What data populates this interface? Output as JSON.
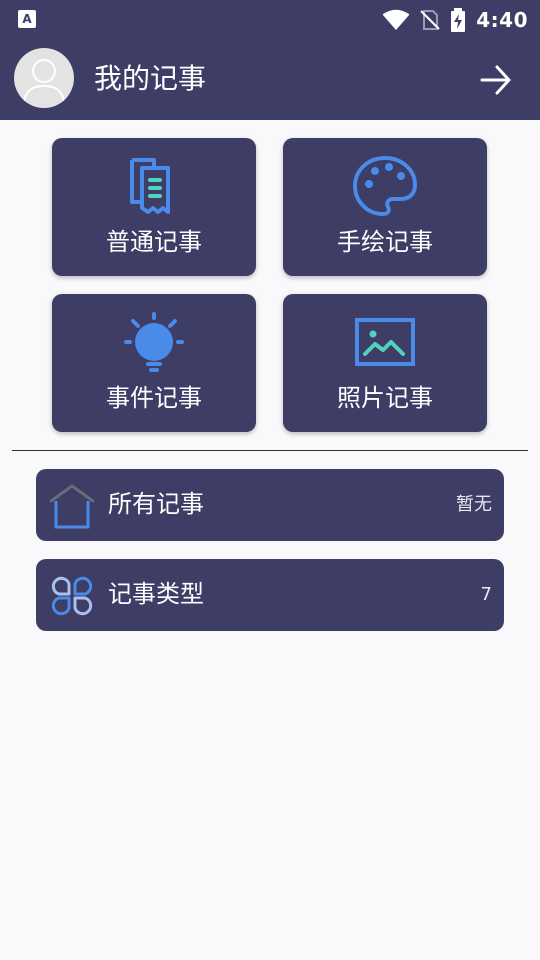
{
  "status_bar": {
    "left_icon": "A",
    "time": "4:40",
    "icons": [
      "wifi-icon",
      "no-sim-icon",
      "battery-charging-icon"
    ]
  },
  "header": {
    "title": "我的记事",
    "avatar_icon": "user-avatar-icon",
    "action_icon": "arrow-right-icon"
  },
  "tiles": [
    {
      "label": "普通记事",
      "icon": "receipt-notes-icon"
    },
    {
      "label": "手绘记事",
      "icon": "palette-icon"
    },
    {
      "label": "事件记事",
      "icon": "lightbulb-icon"
    },
    {
      "label": "照片记事",
      "icon": "image-icon"
    }
  ],
  "list": [
    {
      "label": "所有记事",
      "value": "暂无",
      "icon": "home-icon"
    },
    {
      "label": "记事类型",
      "value": "7",
      "icon": "category-grid-icon"
    }
  ],
  "colors": {
    "primary": "#3d3d66",
    "icon_blue": "#4a8ae8",
    "icon_teal": "#4fd2c0",
    "background": "#f9f9fb"
  }
}
